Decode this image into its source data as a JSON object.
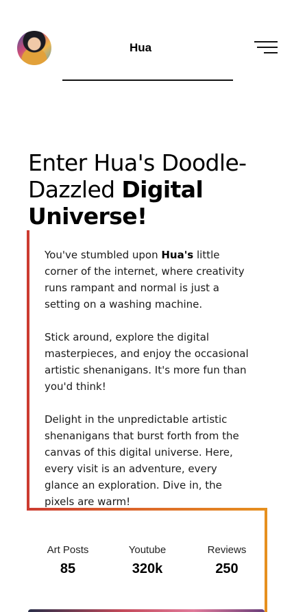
{
  "header": {
    "brand": "Hua",
    "avatar_icon": "avatar-portrait",
    "menu_icon": "hamburger-menu-icon"
  },
  "hero": {
    "headline_part1": "Enter Hua's Doodle-Dazzled ",
    "headline_part2": "Digital Universe!"
  },
  "intro": {
    "p1_before": "You've stumbled upon ",
    "p1_bold": "Hua's",
    "p1_after": " little corner of the internet, where creativity runs rampant and normal is just a setting on a washing machine.",
    "p2": "Stick around, explore the digital masterpieces, and enjoy the occasional artistic shenanigans. It's more fun than you'd think!",
    "p3": "Delight in the unpredictable artistic shenanigans that burst forth from the canvas of this digital universe. Here, every visit is an adventure, every glance an exploration. Dive in, the pixels are warm!"
  },
  "stats": [
    {
      "label": "Art Posts",
      "value": "85"
    },
    {
      "label": "Youtube",
      "value": "320k"
    },
    {
      "label": "Reviews",
      "value": "250"
    }
  ],
  "colors": {
    "accent_red": "#cc3b30",
    "accent_orange": "#e6901e"
  }
}
